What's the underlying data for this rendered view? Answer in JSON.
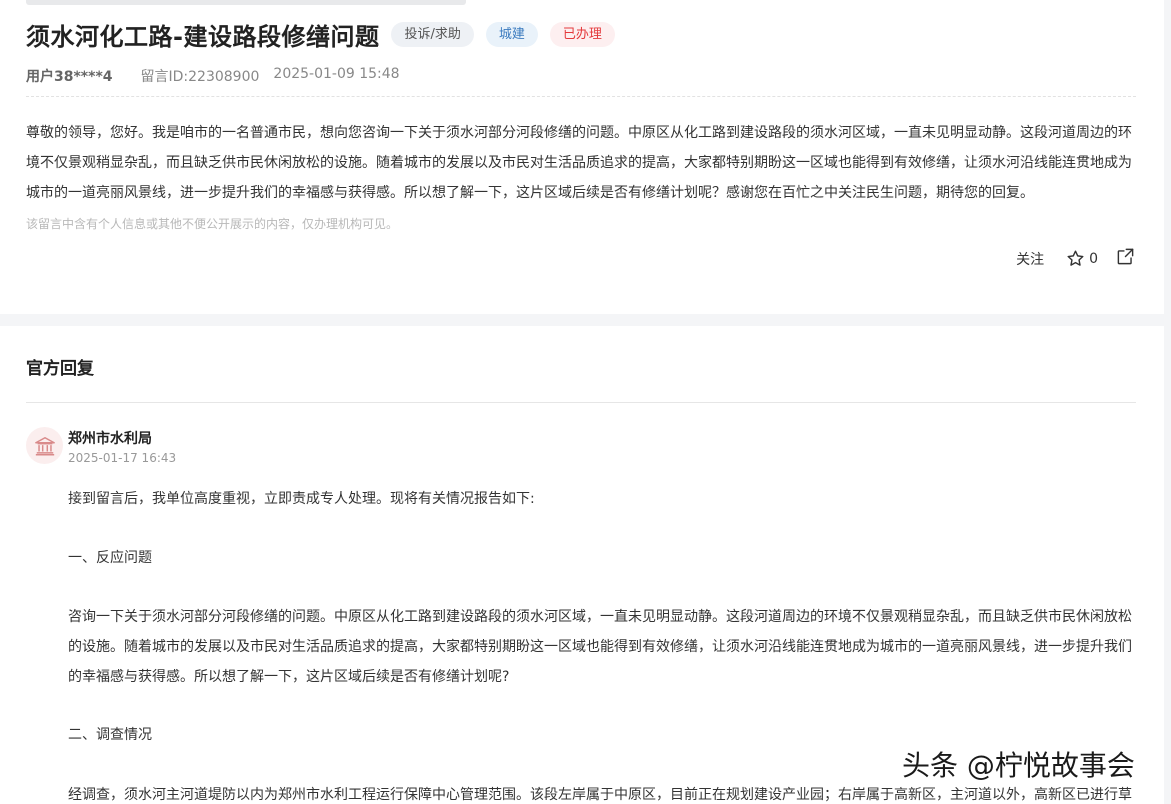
{
  "question": {
    "title": "须水河化工路-建设路段修缮问题",
    "tags": [
      "投诉/求助",
      "城建",
      "已办理"
    ],
    "user": "用户38****4",
    "message_id": "留言ID:22308900",
    "time": "2025-01-09 15:48",
    "body": "尊敬的领导，您好。我是咱市的一名普通市民，想向您咨询一下关于须水河部分河段修缮的问题。中原区从化工路到建设路段的须水河区域，一直未见明显动静。这段河道周边的环境不仅景观稍显杂乱，而且缺乏供市民休闲放松的设施。随着城市的发展以及市民对生活品质追求的提高，大家都特别期盼这一区域也能得到有效修缮，让须水河沿线能连贯地成为城市的一道亮丽风景线，进一步提升我们的幸福感与获得感。所以想了解一下，这片区域后续是否有修缮计划呢？感谢您在百忙之中关注民生问题，期待您的回复。",
    "privacy_notice": "该留言中含有个人信息或其他不便公开展示的内容，仅办理机构可见。",
    "follow_label": "关注",
    "star_count": "0"
  },
  "reply": {
    "section_title": "官方回复",
    "org_name": "郑州市水利局",
    "time": "2025-01-17 16:43",
    "p1": "接到留言后，我单位高度重视，立即责成专人处理。现将有关情况报告如下:",
    "h1": "一、反应问题",
    "p2": "咨询一下关于须水河部分河段修缮的问题。中原区从化工路到建设路段的须水河区域，一直未见明显动静。这段河道周边的环境不仅景观稍显杂乱，而且缺乏供市民休闲放松的设施。随着城市的发展以及市民对生活品质追求的提高，大家都特别期盼这一区域也能得到有效修缮，让须水河沿线能连贯地成为城市的一道亮丽风景线，进一步提升我们的幸福感与获得感。所以想了解一下，这片区域后续是否有修缮计划呢?",
    "h2": "二、调查情况",
    "p3": "经调查，须水河主河道堤防以内为郑州市水利工程运行保障中心管理范围。该段左岸属于中原区，目前正在规划建设产业园；右岸属于高新区，主河道以外，高新区已进行草"
  },
  "watermark": "头条 @柠悦故事会"
}
